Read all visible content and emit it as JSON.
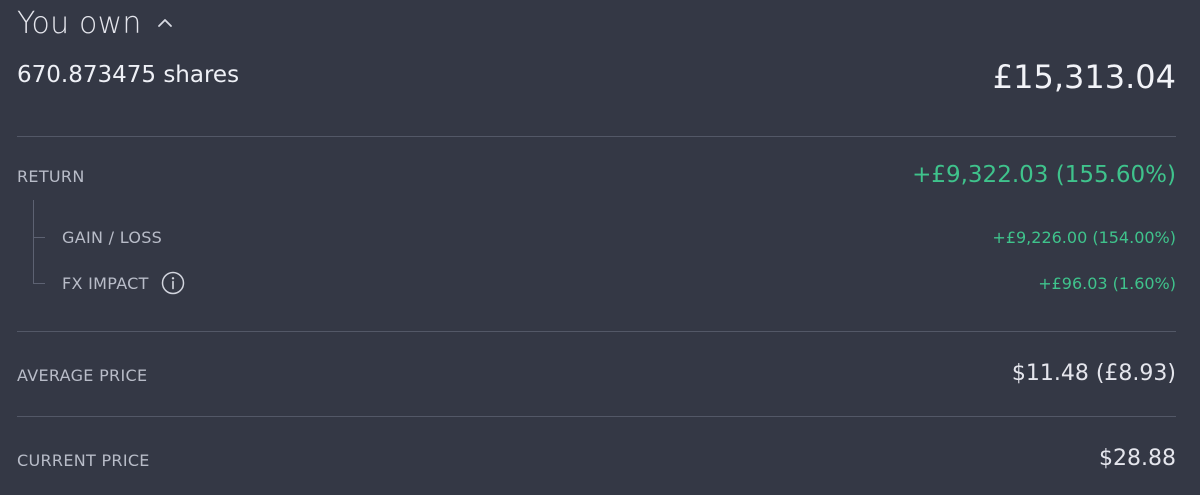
{
  "header": {
    "title": "You own",
    "toggle_icon": "chevron-up-icon"
  },
  "holding": {
    "shares": "670.873475 shares",
    "total_value": "£15,313.04"
  },
  "return": {
    "label": "RETURN",
    "value": "+£9,322.03 (155.60%)",
    "gain_loss": {
      "label": "GAIN / LOSS",
      "value": "+£9,226.00 (154.00%)"
    },
    "fx_impact": {
      "label": "FX IMPACT",
      "info_icon": "info-icon",
      "value": "+£96.03 (1.60%)"
    }
  },
  "average_price": {
    "label": "AVERAGE PRICE",
    "value": "$11.48 (£8.93)"
  },
  "current_price": {
    "label": "CURRENT PRICE",
    "value": "$28.88"
  },
  "colors": {
    "background": "#343845",
    "positive": "#3fc38c",
    "divider": "#535867"
  }
}
